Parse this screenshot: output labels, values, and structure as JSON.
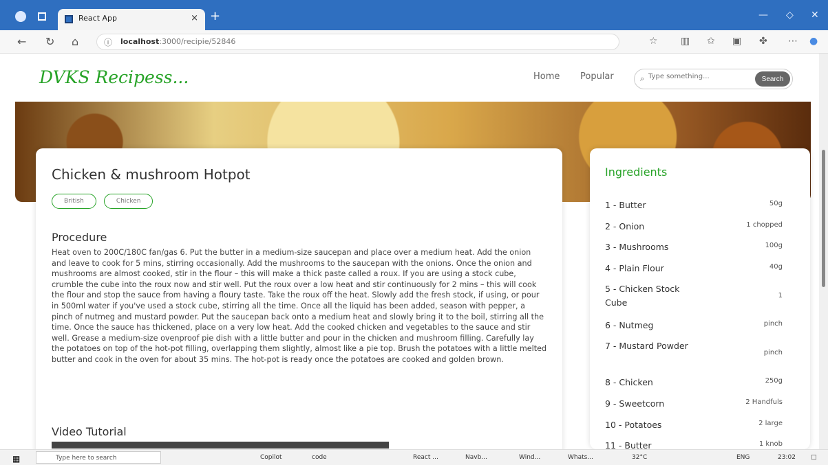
{
  "browser": {
    "tab_title": "React App",
    "url_host": "localhost",
    "url_path": ":3000/recipie/52846",
    "new_tab": "+",
    "tab_close": "×"
  },
  "site": {
    "logo": "DVKS Recipess...",
    "menu": [
      "Home",
      "Popular"
    ],
    "search_placeholder": "Type something...",
    "search_button": "Search"
  },
  "recipe": {
    "title": "Chicken & mushroom Hotpot",
    "tags": [
      "British",
      "Chicken"
    ],
    "procedure_heading": "Procedure",
    "procedure": "Heat oven to 200C/180C fan/gas 6. Put the butter in a medium-size saucepan and place over a medium heat. Add the onion and leave to cook for 5 mins, stirring occasionally. Add the mushrooms to the saucepan with the onions. Once the onion and mushrooms are almost cooked, stir in the flour – this will make a thick paste called a roux. If you are using a stock cube, crumble the cube into the roux now and stir well. Put the roux over a low heat and stir continuously for 2 mins – this will cook the flour and stop the sauce from having a floury taste. Take the roux off the heat. Slowly add the fresh stock, if using, or pour in 500ml water if you've used a stock cube, stirring all the time. Once all the liquid has been added, season with pepper, a pinch of nutmeg and mustard powder. Put the saucepan back onto a medium heat and slowly bring it to the boil, stirring all the time. Once the sauce has thickened, place on a very low heat. Add the cooked chicken and vegetables to the sauce and stir well. Grease a medium-size ovenproof pie dish with a little butter and pour in the chicken and mushroom filling. Carefully lay the potatoes on top of the hot-pot filling, overlapping them slightly, almost like a pie top. Brush the potatoes with a little melted butter and cook in the oven for about 35 mins. The hot-pot is ready once the potatoes are cooked and golden brown.",
    "video_heading": "Video Tutorial"
  },
  "ingredients": {
    "heading": "Ingredients",
    "items": [
      {
        "name": "1 - Butter",
        "qty": "50g"
      },
      {
        "name": "2 - Onion",
        "qty": "1 chopped"
      },
      {
        "name": "3 - Mushrooms",
        "qty": "100g"
      },
      {
        "name": "4 - Plain Flour",
        "qty": "40g"
      },
      {
        "name": "5 - Chicken Stock Cube",
        "qty": "1"
      },
      {
        "name": "6 - Nutmeg",
        "qty": "pinch"
      },
      {
        "name": "7 - Mustard Powder",
        "qty": "pinch"
      },
      {
        "name": "8 - Chicken",
        "qty": "250g"
      },
      {
        "name": "9 - Sweetcorn",
        "qty": "2 Handfuls"
      },
      {
        "name": "10 - Potatoes",
        "qty": "2 large"
      },
      {
        "name": "11 - Butter",
        "qty": "1 knob"
      }
    ]
  },
  "taskbar": {
    "search_placeholder": "Type here to search",
    "apps": [
      "Copilot",
      "code",
      "React ...",
      "Navb...",
      "Wind...",
      "Whats..."
    ],
    "weather": "32°C",
    "language": "ENG",
    "time": "23:02"
  }
}
